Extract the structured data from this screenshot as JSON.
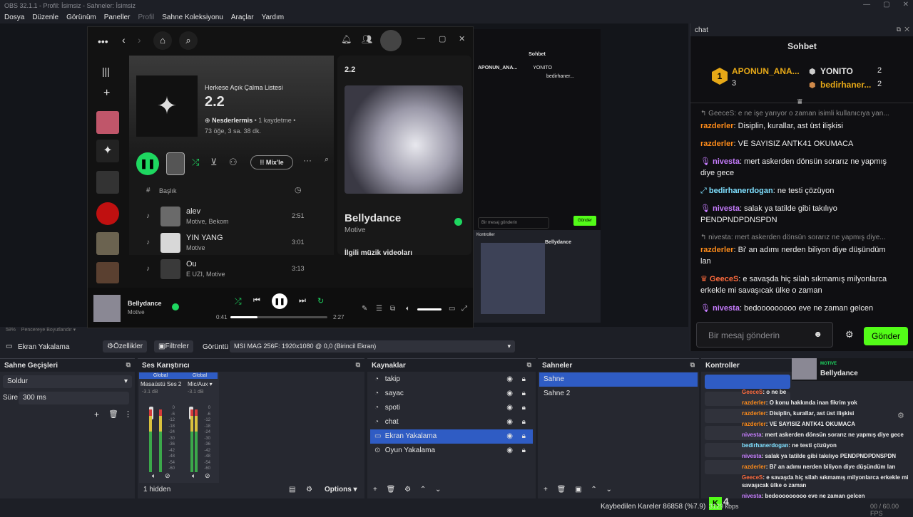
{
  "window": {
    "title": "OBS 32.1.1 - Profil: İsimsiz - Sahneler: İsimsiz"
  },
  "menu": [
    "Dosya",
    "Düzenle",
    "Görünüm",
    "Paneller",
    "Profil",
    "Sahne Koleksiyonu",
    "Araçlar",
    "Yardım"
  ],
  "spotify": {
    "playlist_kind": "Herkese Açık Çalma Listesi",
    "playlist_title": "2.2",
    "owner": "Nesderlermis",
    "saves": "• 1 kaydetme •",
    "meta": "73 öğe, 3 sa. 38 dk.",
    "mix_label": "Mix'le",
    "header_num": "#",
    "header_title": "Başlık",
    "tracks": [
      {
        "title": "alev",
        "artist": "Motive, Bekom",
        "duration": "2:51"
      },
      {
        "title": "YIN YANG",
        "artist": "Motive",
        "duration": "3:01"
      },
      {
        "title": "Ou",
        "artist": "E UZI, Motive",
        "duration": "3:13"
      }
    ],
    "right_title": "2.2",
    "np_title": "Bellydance",
    "np_artist": "Motive",
    "videos_label": "İlgili müzik videoları",
    "elapsed": "0:41",
    "total": "2:27"
  },
  "chat": {
    "dock_title": "chat",
    "header": "Sohbet",
    "leader": {
      "name": "APONUN_ANA...",
      "count": "3"
    },
    "top2": {
      "name": "YONITO",
      "count": "2"
    },
    "top3": {
      "name": "bedirhaner...",
      "count": "2"
    },
    "reply_hint": "GeeceS: e ne işe yarıyor o zaman isimli kullanıcıya yan...",
    "reply_hint2": "nivesta: mert askerden dönsün sorarız ne yapmış diye...",
    "messages": [
      {
        "user": "razderler",
        "text": "Disiplin, kurallar, ast üst ilişkisi",
        "color": "#ff8c1a"
      },
      {
        "user": "razderler",
        "text": "VE SAYISIZ ANTK41 OKUMACA",
        "color": "#ff8c1a"
      },
      {
        "user": "nivesta",
        "text": "mert askerden dönsün sorarız ne yapmış diye gece",
        "color": "#c77dff"
      },
      {
        "user": "bedirhanerdogan",
        "text": "ne testi çözüyon",
        "color": "#7fe0ff"
      },
      {
        "user": "nivesta",
        "text": "salak ya tatilde gibi takılıyo PENDPNDPDNSPDN",
        "color": "#c77dff"
      },
      {
        "user": "razderler",
        "text": "Bi' an adımı nerden biliyon diye düşündüm lan",
        "color": "#ff8c1a"
      },
      {
        "user": "GeeceS",
        "text": "e savaşda hiç silah sıkmamış milyonlarca erkekle mi savaşıcak ülke o zaman",
        "color": "#ff6b3d"
      },
      {
        "user": "nivesta",
        "text": "bedooooooooo eve ne zaman gelcen",
        "color": "#c77dff"
      }
    ],
    "input_placeholder": "Bir mesaj gönderin",
    "send_label": "Gönder"
  },
  "source_bar": {
    "name": "Ekran Yakalama",
    "props": "Özellikler",
    "filters": "Filtreler",
    "display_label": "Görüntü",
    "display_value": "MSI MAG 256F: 1920x1080 @ 0,0 (Birincil Ekran)"
  },
  "zoom": {
    "value": "58%",
    "hint": "Pencereye Boyutlandır"
  },
  "transitions": {
    "title": "Sahne Geçişleri",
    "type": "Soldur",
    "duration_label": "Süre",
    "duration": "300 ms"
  },
  "mixer": {
    "title": "Ses Karıştırıcı",
    "ch1": {
      "tag": "Global",
      "name": "Masaüstü Ses 2",
      "db": "-3.1 dB"
    },
    "ch2": {
      "tag": "Global",
      "name": "Mic/Aux",
      "db": "-3.1 dB"
    },
    "hidden": "1 hidden",
    "options": "Options",
    "ticks": [
      "0",
      "-6",
      "-12",
      "-18",
      "-24",
      "-30",
      "-36",
      "-42",
      "-48",
      "-54",
      "-60"
    ]
  },
  "sources": {
    "title": "Kaynaklar",
    "items": [
      "takip",
      "sayac",
      "spoti",
      "chat",
      "Ekran Yakalama",
      "Oyun Yakalama"
    ]
  },
  "scenes": {
    "title": "Sahneler",
    "items": [
      "Sahne",
      "Sahne 2"
    ]
  },
  "controls": {
    "title": "Kontroller",
    "np_tag": "MOTIVE",
    "np_title": "Bellydance"
  },
  "overlay_chat": [
    {
      "user": "GeeceS",
      "text": "o ne be",
      "color": "#ff6b3d"
    },
    {
      "user": "razderler",
      "text": "O konu hakkında inan fikrim yok",
      "color": "#ff8c1a"
    },
    {
      "user": "razderler",
      "text": "Disiplin, kurallar, ast üst ilişkisi",
      "color": "#ff8c1a"
    },
    {
      "user": "razderler",
      "text": "VE SAYISIZ ANTK41 OKUMACA",
      "color": "#ff8c1a"
    },
    {
      "user": "nivesta",
      "text": "mert askerden dönsün sorarız ne yapmış diye gece",
      "color": "#c77dff"
    },
    {
      "user": "bedirhanerdogan",
      "text": "ne testi çözüyon",
      "color": "#7fe0ff"
    },
    {
      "user": "nivesta",
      "text": "salak ya tatilde gibi takılıyo PENDPNDPDNSPDN",
      "color": "#c77dff"
    },
    {
      "user": "razderler",
      "text": "Bi' an adımı nerden biliyon diye düşündüm lan",
      "color": "#ff8c1a"
    },
    {
      "user": "GeeceS",
      "text": "e savaşda hiç silah sıkmamış milyonlarca erkekle mi savaşıcak ülke o zaman",
      "color": "#ff6b3d"
    },
    {
      "user": "nivesta",
      "text": "bedooooooooo eve ne zaman gelcen",
      "color": "#c77dff"
    }
  ],
  "status": {
    "dropped": "Kaybedilen Kareler 86858 (%7.9)",
    "kbps": "3129 kbps",
    "fps": "00 / 60.00 FPS",
    "kick_count": "4"
  }
}
